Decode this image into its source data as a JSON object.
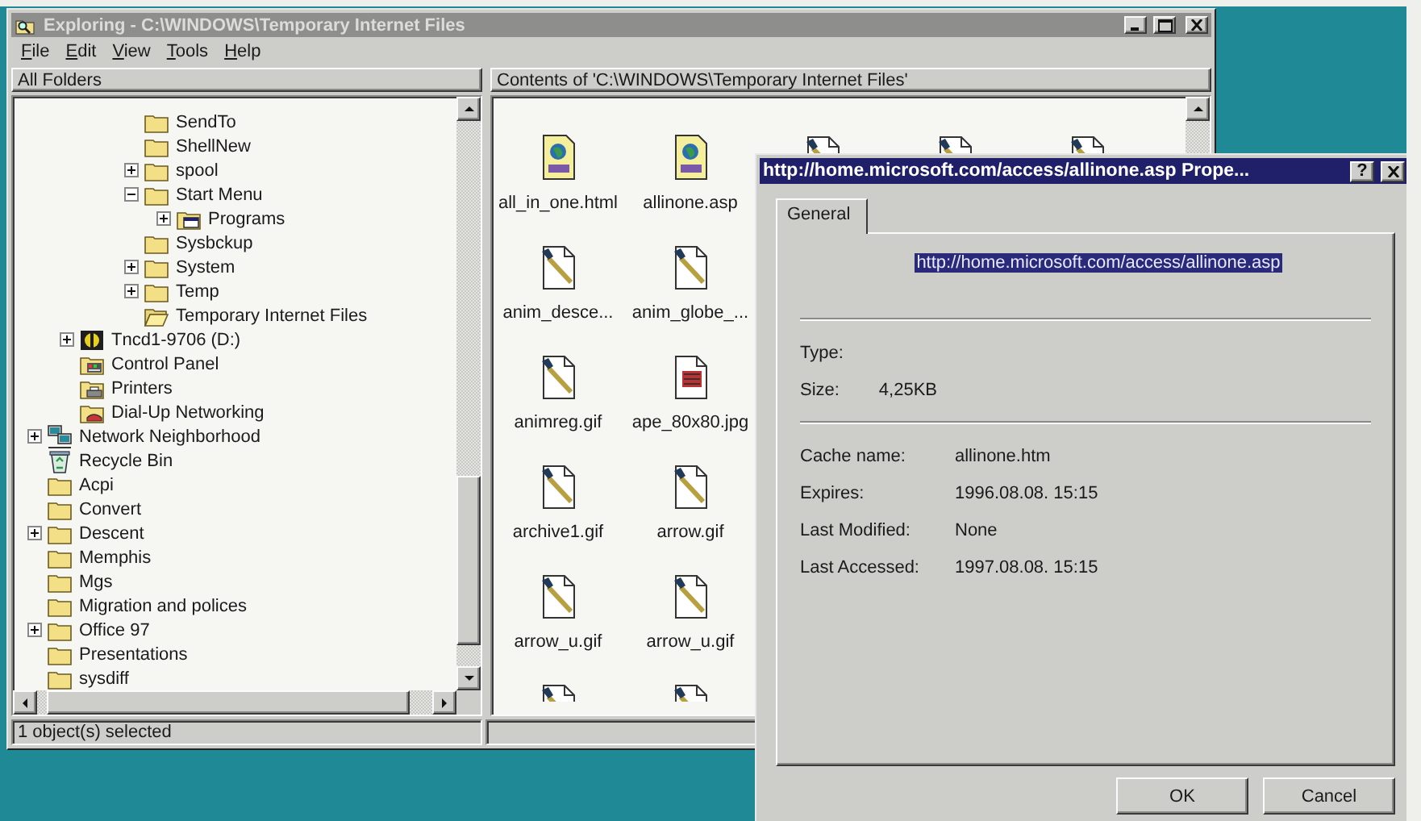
{
  "explorer": {
    "title": "Exploring - C:\\WINDOWS\\Temporary Internet Files",
    "active": false,
    "menu": [
      "File",
      "Edit",
      "View",
      "Tools",
      "Help"
    ],
    "tree": {
      "header": "All Folders",
      "items": [
        {
          "children": [
            {
              "children": [
                {
                  "children": [
                    {
                      "children": [
                        {
                          "label": "SendTo",
                          "kind": "folder"
                        },
                        {
                          "label": "ShellNew",
                          "kind": "folder"
                        },
                        {
                          "label": "spool",
                          "kind": "folder",
                          "expanded": false
                        },
                        {
                          "label": "Start Menu",
                          "kind": "folder",
                          "expanded": true,
                          "children": [
                            {
                              "label": "Programs",
                              "kind": "program-group",
                              "expanded": false
                            }
                          ]
                        },
                        {
                          "label": "Sysbckup",
                          "kind": "folder"
                        },
                        {
                          "label": "System",
                          "kind": "folder",
                          "expanded": false
                        },
                        {
                          "label": "Temp",
                          "kind": "folder",
                          "expanded": false
                        },
                        {
                          "label": "Temporary Internet Files",
                          "kind": "open-folder"
                        }
                      ]
                    }
                  ]
                },
                {
                  "label": "Tncd1-9706 (D:)",
                  "kind": "drive",
                  "expanded": false
                },
                {
                  "label": "Control Panel",
                  "kind": "control-panel"
                },
                {
                  "label": "Printers",
                  "kind": "printers"
                },
                {
                  "label": "Dial-Up Networking",
                  "kind": "dial-up"
                }
              ]
            },
            {
              "label": "Network Neighborhood",
              "kind": "network",
              "expanded": false
            },
            {
              "label": "Recycle Bin",
              "kind": "recycle-bin"
            },
            {
              "label": "Acpi",
              "kind": "folder"
            },
            {
              "label": "Convert",
              "kind": "folder"
            },
            {
              "label": "Descent",
              "kind": "folder",
              "expanded": false
            },
            {
              "label": "Memphis",
              "kind": "folder"
            },
            {
              "label": "Mgs",
              "kind": "folder"
            },
            {
              "label": "Migration and polices",
              "kind": "folder"
            },
            {
              "label": "Office 97",
              "kind": "folder",
              "expanded": false
            },
            {
              "label": "Presentations",
              "kind": "folder"
            },
            {
              "label": "sysdiff",
              "kind": "folder"
            }
          ]
        }
      ]
    },
    "contents": {
      "header": "Contents of 'C:\\WINDOWS\\Temporary Internet Files'",
      "rows": [
        [
          {
            "name": "all_in_one.html",
            "kind": "web-page"
          },
          {
            "name": "allinone.asp",
            "kind": "web-page"
          },
          {
            "kind": "image"
          },
          {
            "kind": "image"
          },
          {
            "kind": "image"
          }
        ],
        [
          {
            "name": "anim_desce...",
            "kind": "image"
          },
          {
            "name": "anim_globe_...",
            "kind": "image"
          }
        ],
        [
          {
            "name": "animreg.gif",
            "kind": "image"
          },
          {
            "name": "ape_80x80.jpg",
            "kind": "photo"
          }
        ],
        [
          {
            "name": "archive1.gif",
            "kind": "image"
          },
          {
            "name": "arrow.gif",
            "kind": "image"
          }
        ],
        [
          {
            "name": "arrow_u.gif",
            "kind": "image"
          },
          {
            "name": "arrow_u.gif",
            "kind": "image"
          }
        ],
        [
          {
            "kind": "image"
          },
          {
            "kind": "image"
          }
        ]
      ]
    },
    "status_bar": "1 object(s) selected"
  },
  "dialog": {
    "title": "http://home.microsoft.com/access/allinone.asp Prope...",
    "active": true,
    "help": "?",
    "tabs": [
      {
        "label": "General",
        "selected": true
      }
    ],
    "url": "http://home.microsoft.com/access/allinone.asp",
    "sections": [
      [
        {
          "label": "Type:"
        },
        {
          "label": "Size:",
          "value": "4,25KB"
        }
      ],
      [
        {
          "label": "Cache name:",
          "value": "allinone.htm"
        },
        {
          "label": "Expires:",
          "value": "1996.08.08. 15:15"
        },
        {
          "label": "Last Modified:",
          "value": "None"
        },
        {
          "label": "Last Accessed:",
          "value": "1997.08.08. 15:15"
        }
      ]
    ],
    "buttons": [
      "OK",
      "Cancel"
    ]
  }
}
